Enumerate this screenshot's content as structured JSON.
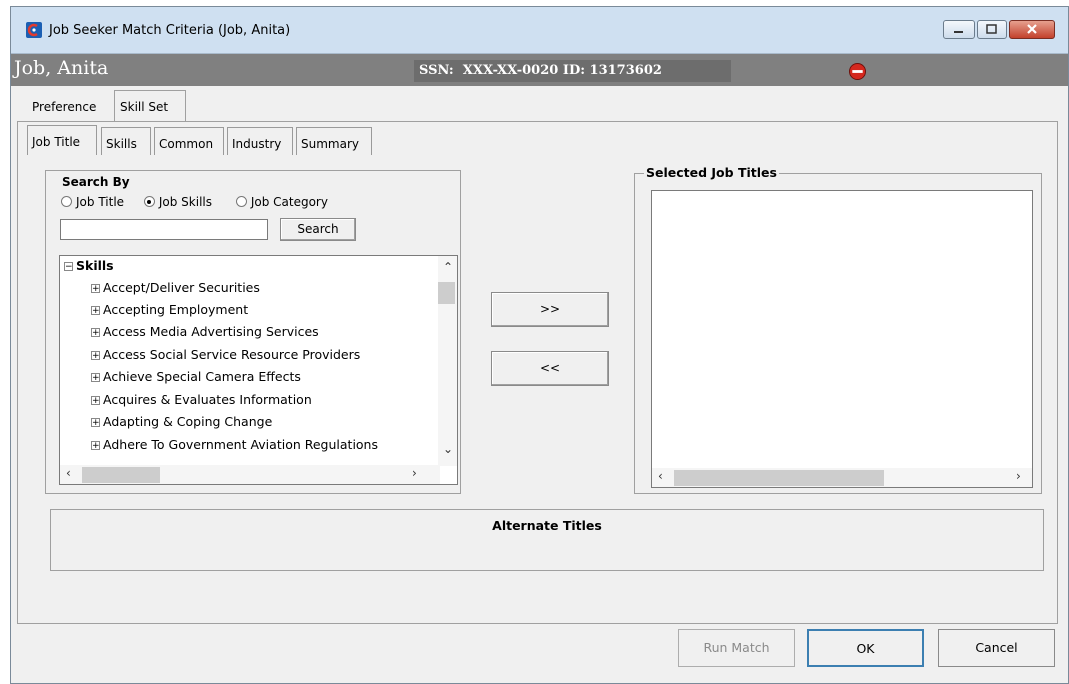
{
  "window": {
    "title": "Job Seeker Match Criteria (Job, Anita)"
  },
  "header": {
    "name": "Job, Anita",
    "ssn_label": "SSN:",
    "ssn_value": "XXX-XX-0020",
    "id_label": "ID:",
    "id_value": "13173602"
  },
  "outer_tabs": [
    {
      "label": "Preference",
      "active": false
    },
    {
      "label": "Skill Set",
      "active": true
    }
  ],
  "inner_tabs": [
    {
      "label": "Job Title",
      "active": true
    },
    {
      "label": "Skills",
      "active": false
    },
    {
      "label": "Common",
      "active": false
    },
    {
      "label": "Industry",
      "active": false
    },
    {
      "label": "Summary",
      "active": false
    }
  ],
  "search": {
    "group_label": "Search By",
    "options": [
      "Job Title",
      "Job Skills",
      "Job Category"
    ],
    "selected": "Job Skills",
    "input_value": "",
    "button_label": "Search"
  },
  "tree": {
    "root_label": "Skills",
    "items": [
      "Accept/Deliver Securities",
      "Accepting Employment",
      "Access Media Advertising Services",
      "Access Social Service Resource Providers",
      "Achieve Special Camera Effects",
      "Acquires & Evaluates Information",
      "Adapting & Coping Change",
      "Adhere To Government Aviation Regulations"
    ]
  },
  "transfer": {
    "add_label": ">>",
    "remove_label": "<<"
  },
  "selected_titles": {
    "label": "Selected Job Titles",
    "items": []
  },
  "alternate_titles": {
    "label": "Alternate Titles"
  },
  "buttons": {
    "run_match": "Run Match",
    "ok": "OK",
    "cancel": "Cancel"
  }
}
